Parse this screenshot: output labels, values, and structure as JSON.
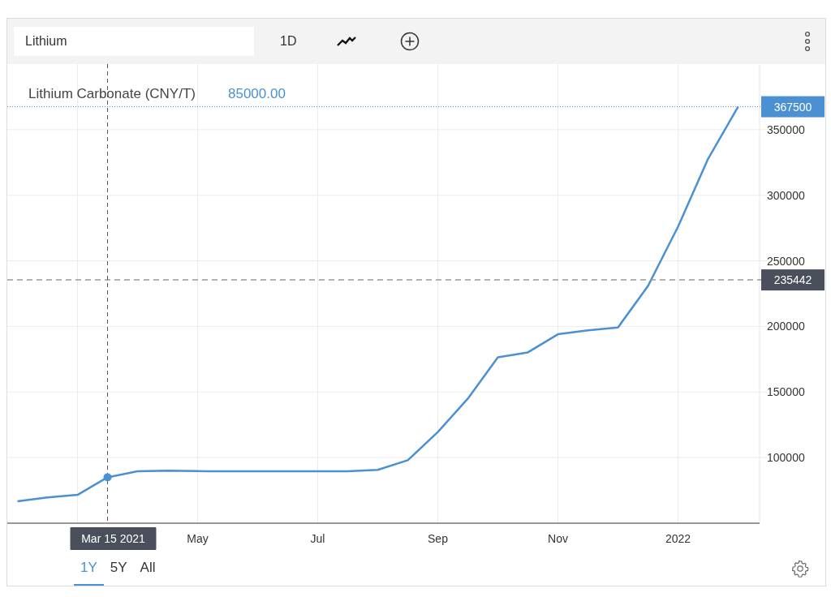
{
  "toolbar": {
    "search_value": "Lithium",
    "interval": "1D"
  },
  "legend": {
    "series_name": "Lithium Carbonate (CNY/T)",
    "hover_value": "85000.00"
  },
  "crosshair": {
    "date_label": "Mar 15 2021"
  },
  "chart_data": {
    "type": "line",
    "grid": true,
    "ylim": [
      50000,
      400000
    ],
    "categories": [
      null,
      null,
      null,
      null,
      null,
      null,
      "May",
      null,
      null,
      null,
      "Jul",
      null,
      null,
      null,
      "Sep",
      null,
      null,
      null,
      "Nov",
      null,
      null,
      null,
      "2022",
      null,
      null
    ],
    "series": [
      {
        "color": "#4a90d2",
        "values": [
          66700,
          69600,
          71600,
          85000,
          89500,
          90100,
          89700,
          89500,
          89500,
          89500,
          89500,
          89500,
          90700,
          98000,
          119500,
          145000,
          176500,
          180200,
          194000,
          197000,
          199200,
          230900,
          276000,
          327800,
          367500
        ]
      }
    ],
    "yticks": [
      100000,
      150000,
      200000,
      250000,
      300000,
      350000
    ],
    "ref_lines": [
      {
        "axis": "y",
        "value": 235442,
        "label": "235442"
      },
      {
        "axis": "y",
        "value": 367500,
        "label": "367500"
      }
    ]
  },
  "range_buttons": [
    {
      "label": "1Y",
      "selected": true
    },
    {
      "label": "5Y",
      "selected": false
    },
    {
      "label": "All",
      "selected": false
    }
  ]
}
